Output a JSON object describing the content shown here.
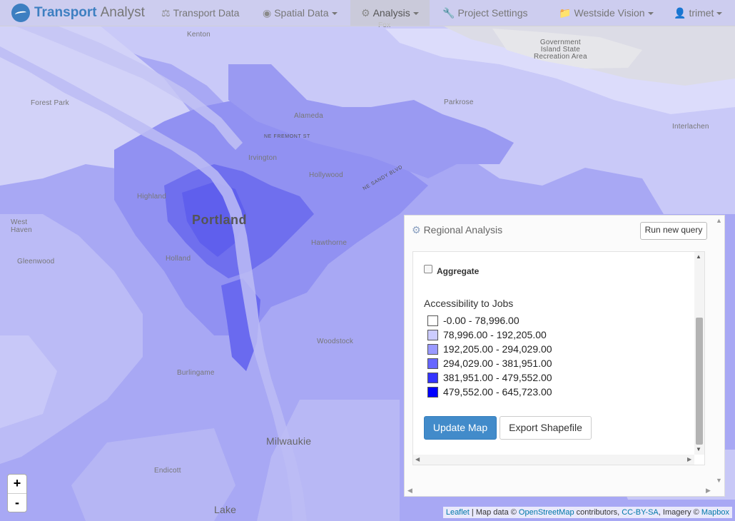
{
  "navbar": {
    "brand_part1": "Transport",
    "brand_part2": "Analyst",
    "items": [
      {
        "label": "Transport Data",
        "icon": "flask-icon"
      },
      {
        "label": "Spatial Data",
        "icon": "globe-icon"
      },
      {
        "label": "Analysis",
        "icon": "gear-icon"
      },
      {
        "label": "Project Settings",
        "icon": "wrench-icon"
      },
      {
        "label": "Westside Vision",
        "icon": "folder-icon"
      },
      {
        "label": "trimet",
        "icon": "user-icon"
      }
    ]
  },
  "map": {
    "labels": {
      "portland": "Portland",
      "milwaukie": "Milwaukie",
      "lake": "Lake",
      "forest_park": "Forest Park",
      "kenton": "Kenton",
      "alameda": "Alameda",
      "irvington": "Irvington",
      "hollywood": "Hollywood",
      "hawthorne": "Hawthorne",
      "woodstock": "Woodstock",
      "burlingame": "Burlingame",
      "west_haven": "West\nHaven",
      "government_island": "Government\nIsland State\nRecreation Area",
      "interlachen": "Interlachen",
      "fremont": "NE FREMONT ST",
      "sandy": "NE SANDY BLVD",
      "gleenwood": "Gleenwood",
      "holland": "Holland",
      "endicott": "Endicott",
      "parkrose": "Parkrose",
      "fox": "Fox",
      "highland": "Highland"
    }
  },
  "zoom": {
    "in": "+",
    "out": "-"
  },
  "attribution": {
    "leaflet": "Leaflet",
    "mapdata": " | Map data © ",
    "osm": "OpenStreetMap",
    "contributors": " contributors, ",
    "ccbysa": "CC-BY-SA",
    "imagery": ", Imagery © ",
    "mapbox": "Mapbox"
  },
  "panel": {
    "title": "Regional Analysis",
    "run_button": "Run new query",
    "aggregate_label": "Aggregate",
    "aggregate_checked": false,
    "legend_title": "Accessibility to Jobs",
    "legend": [
      {
        "range": "-0.00 - 78,996.00",
        "color": "#ffffff"
      },
      {
        "range": "78,996.00 - 192,205.00",
        "color": "#ccccff"
      },
      {
        "range": "192,205.00 - 294,029.00",
        "color": "#9999ff"
      },
      {
        "range": "294,029.00 - 381,951.00",
        "color": "#6666ff"
      },
      {
        "range": "381,951.00 - 479,552.00",
        "color": "#3333ff"
      },
      {
        "range": "479,552.00 - 645,723.00",
        "color": "#0000ff"
      }
    ],
    "update_button": "Update Map",
    "export_button": "Export Shapefile"
  }
}
